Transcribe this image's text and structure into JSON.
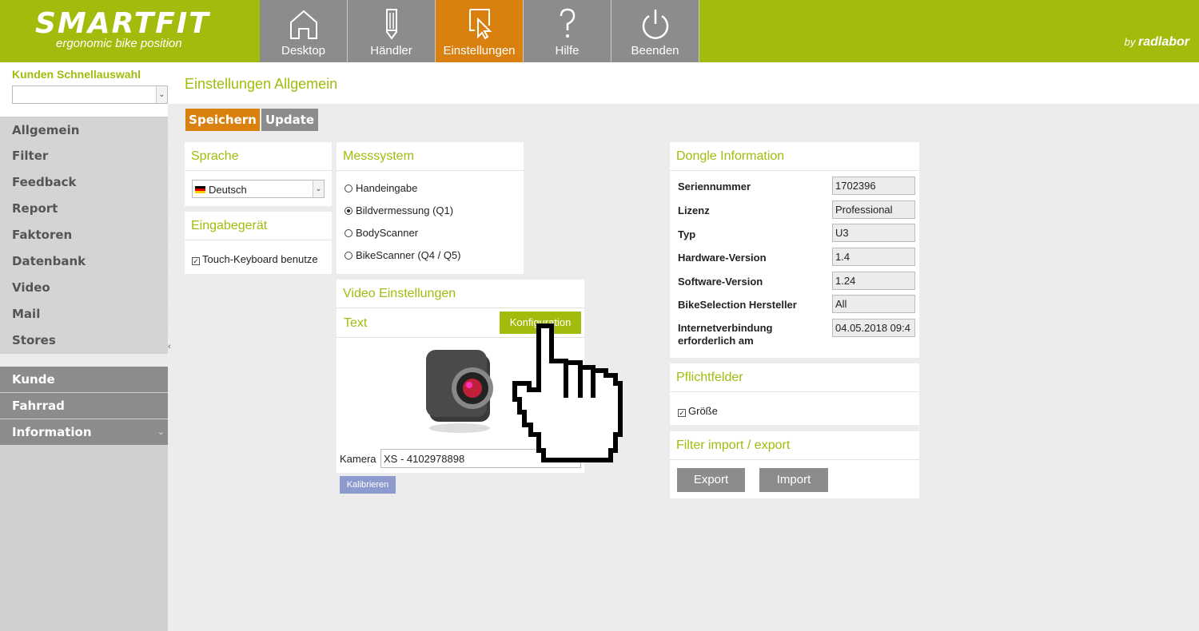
{
  "app": {
    "brand": "smartfit",
    "tagline": "ergonomic bike position",
    "byline_prefix": "by",
    "byline_brand": "radlabor"
  },
  "nav": {
    "tabs": [
      {
        "label": "Desktop",
        "icon": "home-icon"
      },
      {
        "label": "Händler",
        "icon": "pencil-icon"
      },
      {
        "label": "Einstellungen",
        "icon": "cursor-icon",
        "active": true
      },
      {
        "label": "Hilfe",
        "icon": "question-icon"
      },
      {
        "label": "Beenden",
        "icon": "power-icon"
      }
    ]
  },
  "sidebar": {
    "quick_title": "Kunden Schnellauswahl",
    "quick_value": "",
    "items": [
      "Allgemein",
      "Filter",
      "Feedback",
      "Report",
      "Faktoren",
      "Datenbank",
      "Video",
      "Mail",
      "Stores"
    ],
    "sections": [
      "Kunde",
      "Fahrrad",
      "Information"
    ],
    "collapse_glyph": "‹",
    "chevron_glyph": "⌄"
  },
  "page": {
    "title": "Einstellungen Allgemein",
    "save_label": "Speichern",
    "update_label": "Update"
  },
  "sprache": {
    "title": "Sprache",
    "value": "Deutsch"
  },
  "eingabe": {
    "title": "Eingabegerät",
    "checkbox_label": "Touch-Keyboard benutze",
    "checked": true
  },
  "mess": {
    "title": "Messsystem",
    "options": [
      "Handeingabe",
      "Bildvermessung (Q1)",
      "BodyScanner",
      "BikeScanner (Q4 / Q5)"
    ],
    "selected_index": 1
  },
  "video": {
    "title": "Video Einstellungen",
    "subtitle": "Text",
    "config_label": "Konfiguration",
    "camera_label": "Kamera",
    "camera_value": "XS - 4102978898",
    "calibrate_label": "Kalibrieren"
  },
  "dongle": {
    "title": "Dongle Information",
    "rows": [
      {
        "label": "Seriennummer",
        "value": "1702396"
      },
      {
        "label": "Lizenz",
        "value": "Professional"
      },
      {
        "label": "Typ",
        "value": "U3"
      },
      {
        "label": "Hardware-Version",
        "value": "1.4"
      },
      {
        "label": "Software-Version",
        "value": "1.24"
      },
      {
        "label": "BikeSelection Hersteller",
        "value": "All"
      },
      {
        "label": "Internetverbindung erforderlich am",
        "value": "04.05.2018 09:4"
      }
    ]
  },
  "pflicht": {
    "title": "Pflichtfelder",
    "checkbox_label": "Größe",
    "checked": true
  },
  "filter_io": {
    "title": "Filter import / export",
    "export_label": "Export",
    "import_label": "Import"
  },
  "colors": {
    "accent": "#a3bb0c",
    "active": "#d9800f",
    "gray": "#8c8c8c"
  }
}
